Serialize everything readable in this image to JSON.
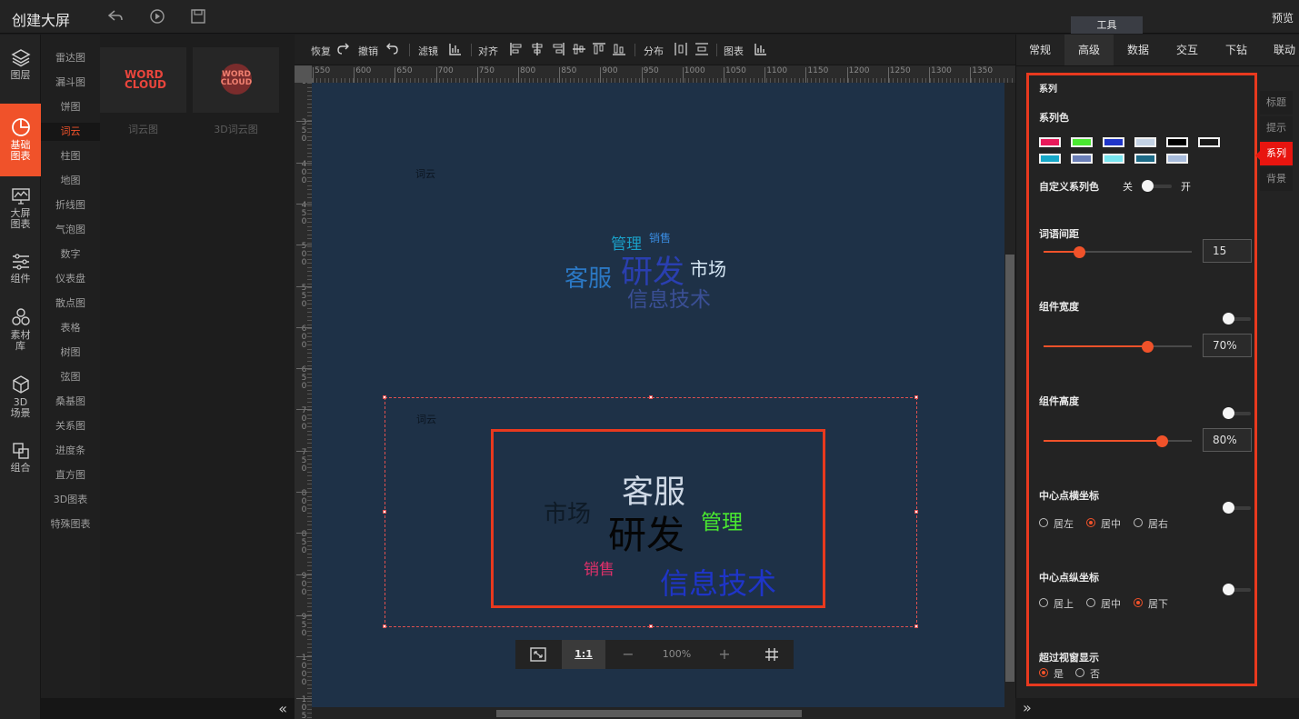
{
  "header": {
    "title": "创建大屏",
    "preview": "预览",
    "tools_tab": "工具"
  },
  "rail": [
    {
      "label": "图层",
      "icon": "layers-icon"
    },
    {
      "label": "基础\n图表",
      "icon": "pie-chart-icon",
      "active": true
    },
    {
      "label": "大屏\n图表",
      "icon": "monitor-chart-icon"
    },
    {
      "label": "组件",
      "icon": "sliders-icon"
    },
    {
      "label": "素材\n库",
      "icon": "material-icon"
    },
    {
      "label": "3D\n场景",
      "icon": "cube-icon"
    },
    {
      "label": "组合",
      "icon": "combine-icon"
    }
  ],
  "categories": [
    "雷达图",
    "漏斗图",
    "饼图",
    "词云",
    "柱图",
    "地图",
    "折线图",
    "气泡图",
    "数字",
    "仪表盘",
    "散点图",
    "表格",
    "树图",
    "弦图",
    "桑基图",
    "关系图",
    "进度条",
    "直方图",
    "3D图表",
    "特殊图表"
  ],
  "active_category": "词云",
  "thumbs": [
    {
      "label": "词云图",
      "art_line1": "WORD",
      "art_line2": "CLOUD"
    },
    {
      "label": "3D词云图",
      "art_line1": "WORD",
      "art_line2": "CLOUD"
    }
  ],
  "toolbar": {
    "redo": "恢复",
    "undo": "撤销",
    "filter": "滤镜",
    "align": "对齐",
    "distribute": "分布",
    "chart": "图表"
  },
  "ruler": {
    "h_ticks": [
      "550",
      "600",
      "650",
      "700",
      "750",
      "800",
      "850",
      "900",
      "950",
      "1000",
      "1050",
      "1100",
      "1150",
      "1200",
      "1250",
      "1300",
      "1350"
    ],
    "v_ticks": [
      "0",
      "350",
      "400",
      "450",
      "500",
      "550",
      "600",
      "650",
      "700",
      "750",
      "800",
      "850",
      "900",
      "950",
      "1000",
      "1050"
    ]
  },
  "widget1": {
    "title": "词云",
    "words": [
      {
        "text": "管理",
        "color": "#1aa0c8"
      },
      {
        "text": "销售",
        "color": "#3a8ce0"
      },
      {
        "text": "客服",
        "color": "#2b78c4"
      },
      {
        "text": "研发",
        "color": "#2a3fb0"
      },
      {
        "text": "市场",
        "color": "#d7e8f5"
      },
      {
        "text": "信息技术",
        "color": "#3a4f95"
      }
    ]
  },
  "widget2": {
    "title": "词云",
    "words": [
      {
        "text": "客服",
        "color": "#cfd9e6"
      },
      {
        "text": "市场",
        "color": "#0e1a26"
      },
      {
        "text": "研发",
        "color": "#050505"
      },
      {
        "text": "管理",
        "color": "#4ae830"
      },
      {
        "text": "销售",
        "color": "#e0306a"
      },
      {
        "text": "信息技术",
        "color": "#1f35c8"
      }
    ]
  },
  "zoom": {
    "fit": "fit-screen-icon",
    "one_to_one": "1:1",
    "minus": "−",
    "value": "100%",
    "plus": "+",
    "grid": "grid-icon"
  },
  "right_tabs": [
    {
      "label": "常规"
    },
    {
      "label": "高级",
      "active": true
    },
    {
      "label": "数据"
    },
    {
      "label": "交互"
    },
    {
      "label": "下钻"
    },
    {
      "label": "联动"
    }
  ],
  "side_tabs": [
    {
      "label": "标题"
    },
    {
      "label": "提示"
    },
    {
      "label": "系列",
      "active": true
    },
    {
      "label": "背景"
    }
  ],
  "series": {
    "section": "系列",
    "color_label": "系列色",
    "colors_row1": [
      "#e8195a",
      "#4ae830",
      "#1f35c8",
      "#c3d2e4",
      "#000000",
      "#1a1a1a"
    ],
    "colors_row2": [
      "#16a8c8",
      "#6b7fb8",
      "#78e6f0",
      "#1c6a86",
      "#a8bcdc"
    ],
    "custom_color_label": "自定义系列色",
    "off": "关",
    "on": "开",
    "word_gap_label": "词语间距",
    "word_gap_value": "15",
    "word_gap_ratio": 0.24,
    "width_label": "组件宽度",
    "width_value": "70%",
    "width_ratio": 0.7,
    "height_label": "组件高度",
    "height_value": "80%",
    "height_ratio": 0.8,
    "center_x_label": "中心点横坐标",
    "center_x_options": [
      "居左",
      "居中",
      "居右"
    ],
    "center_x_selected": 1,
    "center_y_label": "中心点纵坐标",
    "center_y_options": [
      "居上",
      "居中",
      "居下"
    ],
    "center_y_selected": 2,
    "overflow_label": "超过视窗显示",
    "overflow_options": [
      "是",
      "否"
    ],
    "overflow_selected": 0
  }
}
